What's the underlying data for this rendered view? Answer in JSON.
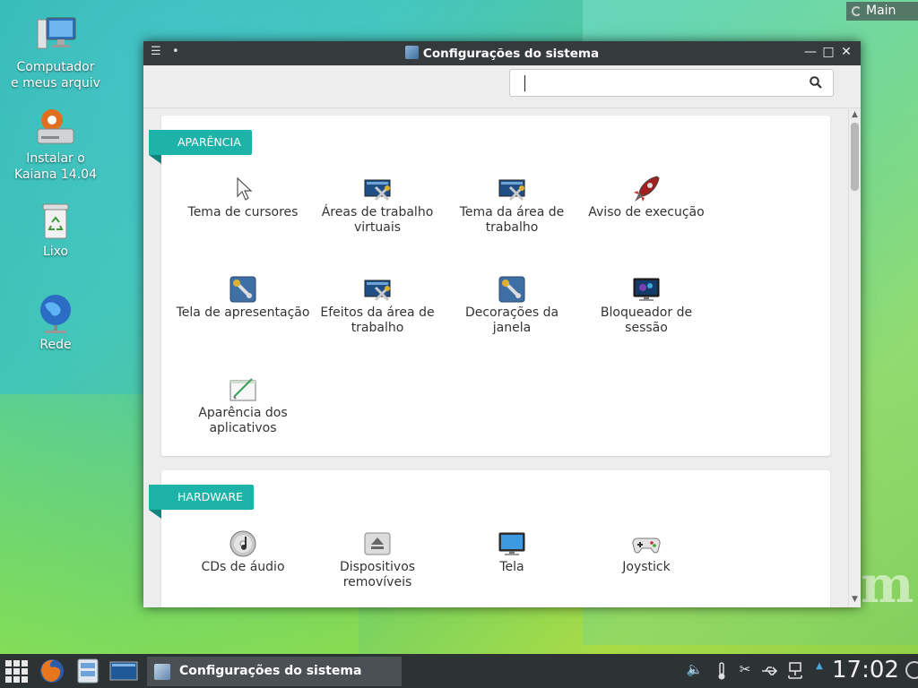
{
  "desktop": {
    "icons": [
      {
        "label": "Computador e meus arquiv",
        "icon": "computer-icon"
      },
      {
        "label": "Instalar o Kaiana 14.04",
        "icon": "installer-icon"
      },
      {
        "label": "Lixo",
        "icon": "trash-icon"
      },
      {
        "label": "Rede",
        "icon": "network-globe-icon"
      }
    ],
    "activity_label": "Main",
    "watermark": "m"
  },
  "window": {
    "title": "Configurações do sistema",
    "search": {
      "value": "",
      "placeholder": ""
    }
  },
  "categories": [
    {
      "name": "APARÊNCIA",
      "items": [
        {
          "label": "Tema de cursores",
          "icon": "cursor-icon"
        },
        {
          "label": "Áreas de trabalho virtuais",
          "icon": "desktop-tools-icon"
        },
        {
          "label": "Tema da área de trabalho",
          "icon": "desktop-theme-icon"
        },
        {
          "label": "Aviso de execução",
          "icon": "rocket-icon"
        },
        {
          "label": "Tela de apresentação",
          "icon": "splash-wrench-icon"
        },
        {
          "label": "Efeitos da área de trabalho",
          "icon": "desktop-effects-icon"
        },
        {
          "label": "Decorações da janela",
          "icon": "window-decoration-icon"
        },
        {
          "label": "Bloqueador de sessão",
          "icon": "screen-lock-icon"
        },
        {
          "label": "Aparência dos aplicativos",
          "icon": "app-appearance-icon"
        }
      ]
    },
    {
      "name": "HARDWARE",
      "items": [
        {
          "label": "CDs de áudio",
          "icon": "audio-cd-icon"
        },
        {
          "label": "Dispositivos removíveis",
          "icon": "eject-icon"
        },
        {
          "label": "Tela",
          "icon": "monitor-icon"
        },
        {
          "label": "Joystick",
          "icon": "gamepad-icon"
        }
      ]
    }
  ],
  "taskbar": {
    "active_task": "Configurações do sistema",
    "clock": "17:02"
  }
}
